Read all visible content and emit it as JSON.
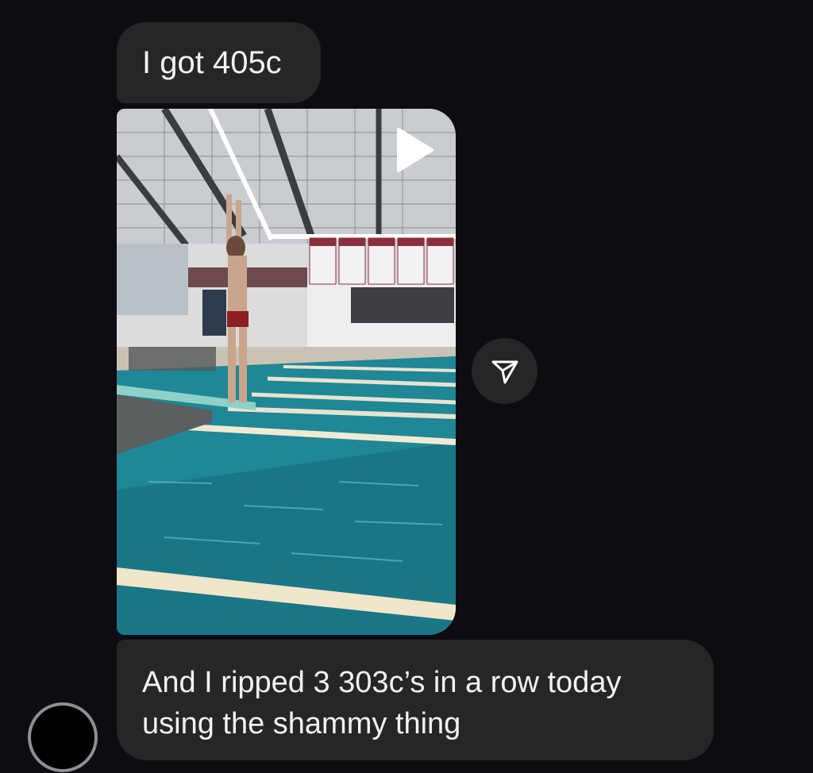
{
  "messages": [
    {
      "text": "I got 405c"
    },
    {
      "text": "And I ripped 3 303c’s in a row today using the shammy thing"
    }
  ],
  "video": {
    "icon": "play-icon"
  },
  "share": {
    "icon": "send-icon"
  },
  "avatar": {
    "icon": "avatar-circle"
  },
  "colors": {
    "background": "#0c0c12",
    "bubble": "#262629",
    "text": "#f2f2f4",
    "pool": "#1e7f8b"
  }
}
